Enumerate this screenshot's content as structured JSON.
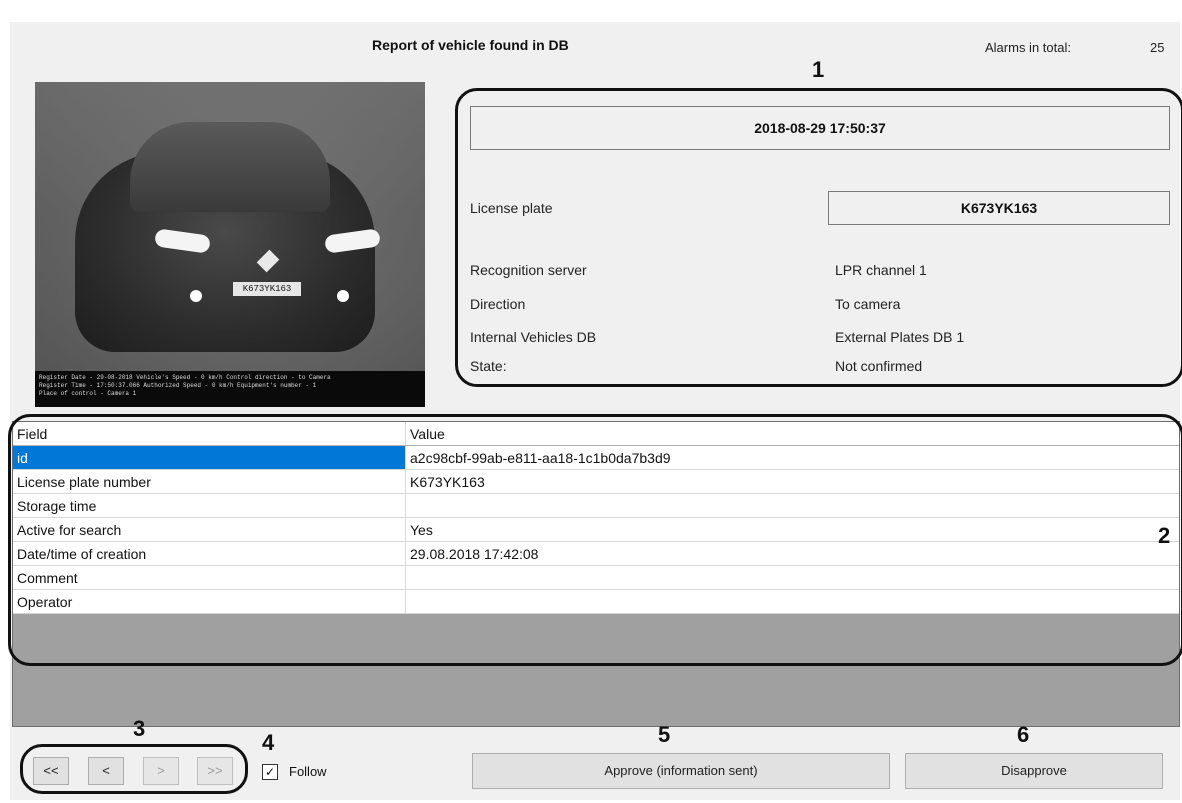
{
  "header": {
    "title": "Report of vehicle found in DB",
    "alarms_label": "Alarms in total:",
    "alarms_count": "25"
  },
  "snapshot": {
    "plate_text": "K673YK163",
    "caption_lines": [
      "Register Date - 29-08-2018   Vehicle's Speed - 0 km/h   Control direction - to Camera",
      "Register Time - 17:50:37.066  Authorized Speed - 0 km/h   Equipment's number - 1",
      "Place of control - Camera 1"
    ]
  },
  "event": {
    "datetime": "2018-08-29 17:50:37",
    "license_plate_label": "License plate",
    "license_plate_value": "K673YK163",
    "fields": [
      {
        "label": "Recognition server",
        "value": "LPR channel 1"
      },
      {
        "label": "Direction",
        "value": "To camera"
      },
      {
        "label": "Internal Vehicles DB",
        "value": "External Plates DB 1"
      },
      {
        "label": "State:",
        "value": "Not confirmed"
      }
    ]
  },
  "grid": {
    "headers": [
      "Field",
      "Value"
    ],
    "rows": [
      {
        "field": "id",
        "value": "a2c98cbf-99ab-e811-aa18-1c1b0da7b3d9"
      },
      {
        "field": "License plate number",
        "value": "K673YK163"
      },
      {
        "field": "Storage time",
        "value": ""
      },
      {
        "field": "Active for search",
        "value": "Yes"
      },
      {
        "field": "Date/time of creation",
        "value": "29.08.2018 17:42:08"
      },
      {
        "field": "Comment",
        "value": ""
      },
      {
        "field": "Operator",
        "value": ""
      }
    ]
  },
  "footer": {
    "nav": {
      "first": "<<",
      "prev": "<",
      "next": ">",
      "last": ">>"
    },
    "follow_label": "Follow",
    "follow_checked": true,
    "approve_label": "Approve (information sent)",
    "disapprove_label": "Disapprove"
  },
  "callouts": [
    "1",
    "2",
    "3",
    "4",
    "5",
    "6"
  ]
}
